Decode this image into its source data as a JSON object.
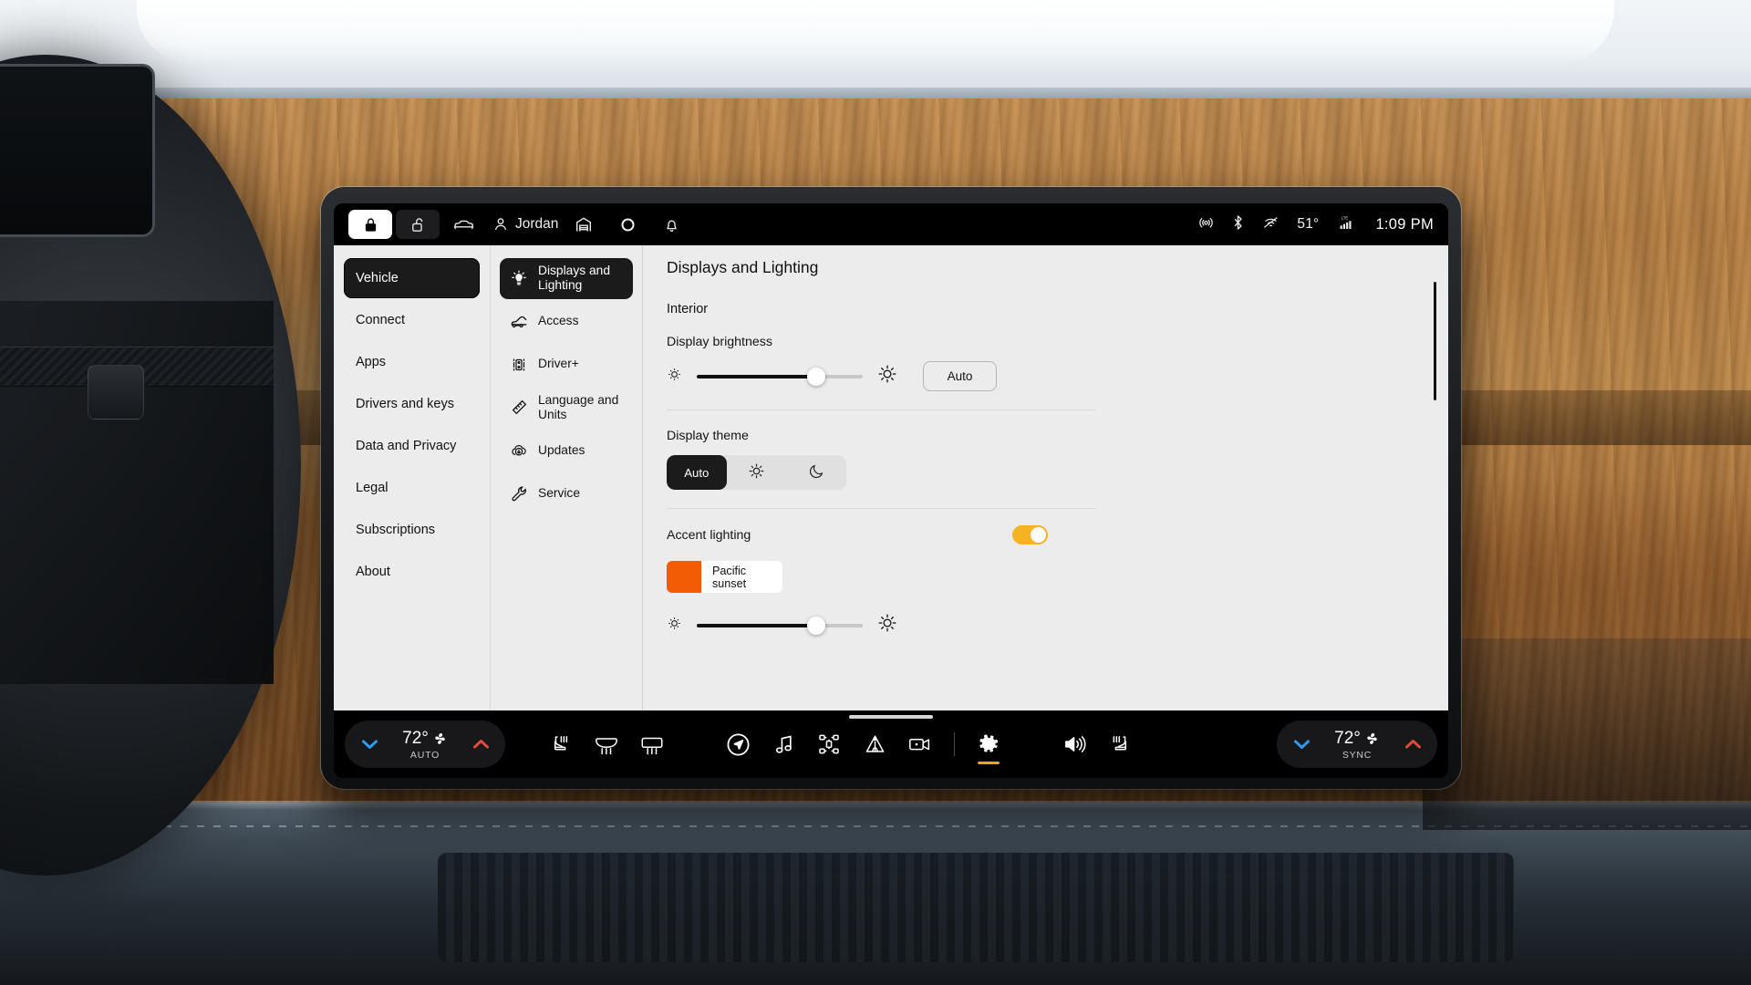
{
  "statusbar": {
    "lock_icon": "lock-closed-icon",
    "unlock_icon": "lock-open-icon",
    "car_icon": "car-icon",
    "profile_icon": "person-icon",
    "profile_name": "Jordan",
    "garage_icon": "garage-icon",
    "ring_icon": "ring-icon",
    "bell_icon": "bell-icon",
    "wifi_hotspot_icon": "hotspot-icon",
    "bluetooth_icon": "bluetooth-icon",
    "wifi_off_icon": "wifi-off-icon",
    "exterior_temp": "51°",
    "cellular_icon": "lte-signal-icon",
    "cellular_label": "LTE",
    "time": "1:09 PM"
  },
  "nav_primary": {
    "items": [
      {
        "label": "Vehicle",
        "selected": true
      },
      {
        "label": "Connect",
        "selected": false
      },
      {
        "label": "Apps",
        "selected": false
      },
      {
        "label": "Drivers and keys",
        "selected": false
      },
      {
        "label": "Data and Privacy",
        "selected": false
      },
      {
        "label": "Legal",
        "selected": false
      },
      {
        "label": "Subscriptions",
        "selected": false
      },
      {
        "label": "About",
        "selected": false
      }
    ]
  },
  "nav_secondary": {
    "items": [
      {
        "label": "Displays and Lighting",
        "icon": "lightbulb-icon",
        "selected": true
      },
      {
        "label": "Access",
        "icon": "car-hood-open-icon",
        "selected": false
      },
      {
        "label": "Driver+",
        "icon": "lane-assist-icon",
        "selected": false
      },
      {
        "label": "Language and Units",
        "icon": "ruler-icon",
        "selected": false
      },
      {
        "label": "Updates",
        "icon": "cloud-download-icon",
        "selected": false
      },
      {
        "label": "Service",
        "icon": "wrench-icon",
        "selected": false
      }
    ]
  },
  "content": {
    "title": "Displays and Lighting",
    "section": "Interior",
    "brightness": {
      "label": "Display brightness",
      "low_icon": "brightness-low-icon",
      "high_icon": "brightness-high-icon",
      "value": 72,
      "auto_label": "Auto"
    },
    "theme": {
      "label": "Display theme",
      "options": [
        {
          "label": "Auto",
          "icon": "",
          "selected": true
        },
        {
          "label": "",
          "icon": "sun-icon",
          "selected": false
        },
        {
          "label": "",
          "icon": "moon-icon",
          "selected": false
        }
      ]
    },
    "accent": {
      "label": "Accent lighting",
      "enabled": true,
      "toggle_color": "#f5b324",
      "color_name": "Pacific sunset",
      "color_hex": "#f25c05",
      "low_icon": "brightness-low-icon",
      "high_icon": "brightness-high-icon",
      "value": 72
    }
  },
  "dock": {
    "climate_left": {
      "down_icon": "chevron-down-icon",
      "temp": "72°",
      "fan_icon": "fan-icon",
      "mode": "AUTO",
      "up_icon": "chevron-up-icon"
    },
    "climate_right": {
      "down_icon": "chevron-down-icon",
      "temp": "72°",
      "fan_icon": "fan-icon",
      "mode": "SYNC",
      "up_icon": "chevron-up-icon"
    },
    "left_icons": [
      {
        "name": "seat-heater-left-icon"
      },
      {
        "name": "windshield-defrost-icon"
      },
      {
        "name": "rear-defrost-icon"
      }
    ],
    "center_icons": [
      {
        "name": "navigation-icon",
        "active": false
      },
      {
        "name": "music-icon",
        "active": false
      },
      {
        "name": "drive-modes-icon",
        "active": false
      },
      {
        "name": "camp-mode-icon",
        "active": false
      },
      {
        "name": "camera-icon",
        "active": false
      },
      {
        "name": "settings-gear-icon",
        "active": true
      }
    ],
    "right_icons": [
      {
        "name": "volume-icon"
      },
      {
        "name": "seat-heater-right-icon"
      }
    ],
    "active_color": "#f0a21e"
  }
}
